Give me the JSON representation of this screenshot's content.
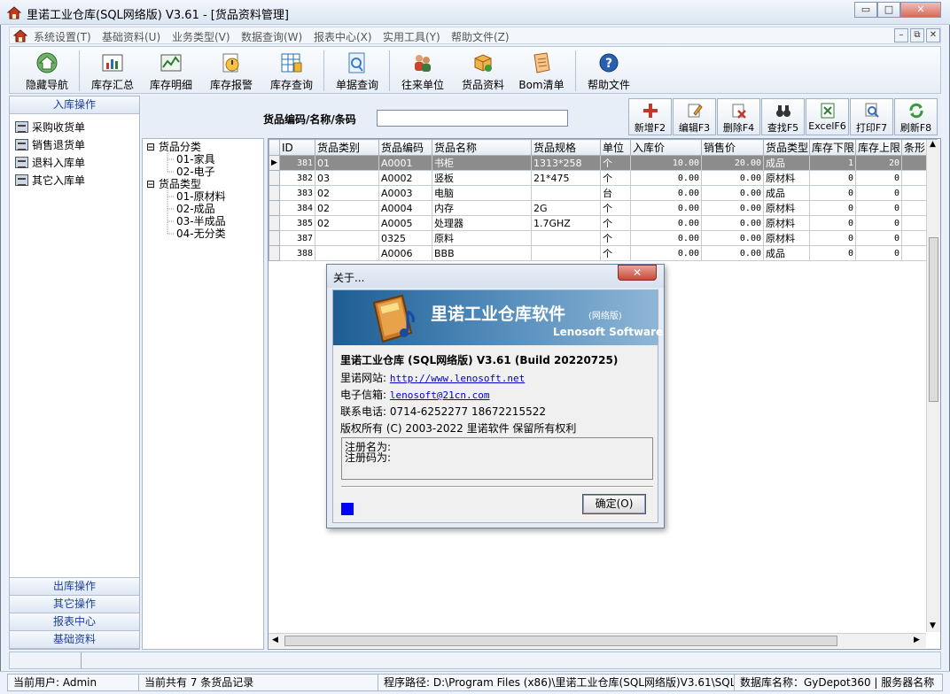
{
  "window": {
    "title": "里诺工业仓库(SQL网络版) V3.61 - [货品资料管理]",
    "min_label": "▭",
    "max_label": "□",
    "close_label": "✕"
  },
  "menu": [
    "系统设置(T)",
    "基础资料(U)",
    "业务类型(V)",
    "数据查询(W)",
    "报表中心(X)",
    "实用工具(Y)",
    "帮助文件(Z)"
  ],
  "mdi_buttons": [
    "–",
    "⧉",
    "✕"
  ],
  "toolbar": {
    "items": [
      {
        "label": "隐藏导航",
        "icon": "home-icon",
        "color": "#3f8a3a"
      },
      {
        "label": "库存汇总",
        "icon": "bar-chart-icon",
        "color": "#c0392b"
      },
      {
        "label": "库存明细",
        "icon": "line-chart-icon",
        "color": "#2e7d32"
      },
      {
        "label": "库存报警",
        "icon": "alarm-icon",
        "color": "#d98f1a"
      },
      {
        "label": "库存查询",
        "icon": "table-icon",
        "color": "#2a6fb0"
      },
      {
        "label": "单据查询",
        "icon": "document-search-icon",
        "color": "#3a7ec0"
      },
      {
        "label": "往来单位",
        "icon": "people-icon",
        "color": "#c8452b"
      },
      {
        "label": "货品资料",
        "icon": "box-icon",
        "color": "#d9911e"
      },
      {
        "label": "Bom清单",
        "icon": "list-icon",
        "color": "#e08a2e"
      },
      {
        "label": "帮助文件",
        "icon": "help-icon",
        "color": "#2a5fb0"
      }
    ]
  },
  "left_panel": {
    "header": "入库操作",
    "items": [
      "采购收货单",
      "销售退货单",
      "退料入库单",
      "其它入库单"
    ],
    "bottom_headers": [
      "出库操作",
      "其它操作",
      "报表中心",
      "基础资料"
    ]
  },
  "search": {
    "label": "货品编码/名称/条码",
    "value": ""
  },
  "actions": [
    {
      "label": "新增F2",
      "icon": "add-icon",
      "color": "#c0392b"
    },
    {
      "label": "编辑F3",
      "icon": "edit-icon",
      "color": "#c77a2a"
    },
    {
      "label": "删除F4",
      "icon": "delete-icon",
      "color": "#c0392b"
    },
    {
      "label": "查找F5",
      "icon": "binoculars-icon",
      "color": "#333333"
    },
    {
      "label": "ExcelF6",
      "icon": "excel-icon",
      "color": "#2e7d32"
    },
    {
      "label": "打印F7",
      "icon": "print-icon",
      "color": "#3a6fb0"
    },
    {
      "label": "刷新F8",
      "icon": "refresh-icon",
      "color": "#3c9a3c"
    }
  ],
  "tree": {
    "nodes": [
      {
        "text": "⊟ 货品分类",
        "level": 0
      },
      {
        "text": "01-家具",
        "level": 1
      },
      {
        "text": "02-电子",
        "level": 1
      },
      {
        "text": "⊟ 货品类型",
        "level": 0
      },
      {
        "text": "01-原材料",
        "level": 1
      },
      {
        "text": "02-成品",
        "level": 1
      },
      {
        "text": "03-半成品",
        "level": 1
      },
      {
        "text": "04-无分类",
        "level": 1
      }
    ]
  },
  "grid": {
    "columns": [
      "ID",
      "货品类别",
      "货品编码",
      "货品名称",
      "货品规格",
      "单位",
      "入库价",
      "销售价",
      "货品类型",
      "库存下限",
      "库存上限",
      "条形"
    ],
    "rows": [
      [
        "381",
        "01",
        "A0001",
        "书柜",
        "1313*258",
        "个",
        "10.00",
        "20.00",
        "成品",
        "1",
        "20",
        ""
      ],
      [
        "382",
        "03",
        "A0002",
        "竖板",
        "21*475",
        "个",
        "0.00",
        "0.00",
        "原材料",
        "0",
        "0",
        ""
      ],
      [
        "383",
        "02",
        "A0003",
        "电脑",
        "",
        "台",
        "0.00",
        "0.00",
        "成品",
        "0",
        "0",
        ""
      ],
      [
        "384",
        "02",
        "A0004",
        "内存",
        "2G",
        "个",
        "0.00",
        "0.00",
        "原材料",
        "0",
        "0",
        ""
      ],
      [
        "385",
        "02",
        "A0005",
        "处理器",
        "1.7GHZ",
        "个",
        "0.00",
        "0.00",
        "原材料",
        "0",
        "0",
        ""
      ],
      [
        "387",
        "",
        "0325",
        "原料",
        "",
        "个",
        "0.00",
        "0.00",
        "原材料",
        "0",
        "0",
        ""
      ],
      [
        "388",
        "",
        "A0006",
        "BBB",
        "",
        "个",
        "0.00",
        "0.00",
        "成品",
        "0",
        "0",
        ""
      ]
    ],
    "selected_row": 0
  },
  "about_dialog": {
    "title": "关于...",
    "banner_title": "里诺工业仓库软件",
    "banner_edition": "(网络版)",
    "banner_company": "Lenosoft Software",
    "product": "里诺工业仓库 (SQL网络版) V3.61 (Build 20220725)",
    "website_label": "里诺网站:",
    "website": "http://www.lenosoft.net",
    "email_label": "电子信箱:",
    "email": "lenosoft@21cn.com",
    "phone_label": "联系电话:",
    "phone": "0714-6252277   18672215522",
    "copyright": "版权所有 (C) 2003-2022 里诺软件 保留所有权利",
    "reg_name": "注册名为:",
    "reg_code": "注册码为:",
    "ok_label": "确定(O)"
  },
  "status": {
    "user": "当前用户: Admin",
    "count": "当前共有 7 条货品记录",
    "path": "程序路径: D:\\Program Files (x86)\\里诺工业仓库(SQL网络版)V3.61\\SQLD",
    "db": "数据库名称：GyDepot360 | 服务器名称"
  }
}
